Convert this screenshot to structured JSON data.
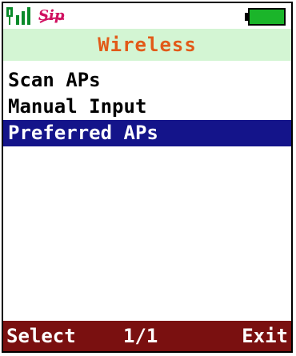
{
  "status": {
    "signal_icon": "signal-strength-icon",
    "logo_text": "Sip",
    "battery_icon": "battery-icon",
    "colors": {
      "signal": "#0b8a2a",
      "logo": "#d01060",
      "battery": "#1bb52a"
    }
  },
  "title": {
    "text": "Wireless",
    "color": "#e25a18",
    "background": "#d3f5d3"
  },
  "menu": {
    "items": [
      {
        "label": "Scan APs",
        "selected": false
      },
      {
        "label": "Manual Input",
        "selected": false
      },
      {
        "label": "Preferred APs",
        "selected": true
      }
    ],
    "selected_color": "#14148a"
  },
  "softkeys": {
    "left": "Select",
    "center": "1/1",
    "right": "Exit",
    "background": "#7a1010"
  }
}
